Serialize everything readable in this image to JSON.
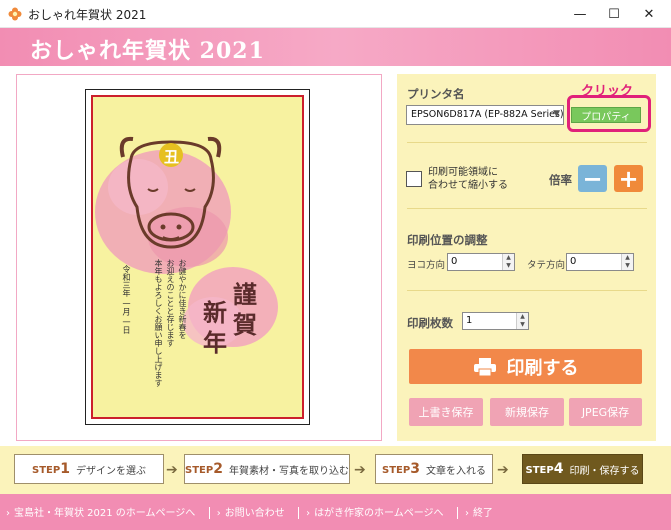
{
  "window": {
    "title": "おしゃれ年賀状 2021",
    "minimize": "—",
    "maximize": "☐",
    "close": "✕"
  },
  "header": {
    "logo": "おしゃれ年賀状 2021"
  },
  "preview": {
    "stamp_text": "丑",
    "greeting_big": [
      "謹",
      "賀",
      "新",
      "年"
    ],
    "body_lines": [
      "お健やかに佳き新春を",
      "お迎えのことと存じます",
      "本年もよろしくお願い申し上げます"
    ],
    "date": "令和三年 一月 一日"
  },
  "settings": {
    "printer_label": "プリンタ名",
    "printer_value": "EPSON6D817A (EP-882A Series)",
    "properties_button": "プロパティ",
    "annotation": "クリック",
    "fit_checkbox_line1": "印刷可能領域に",
    "fit_checkbox_line2": "合わせて縮小する",
    "scale_label": "倍率",
    "minus": "−",
    "plus": "+",
    "position_label": "印刷位置の調整",
    "h_label": "ヨコ方向",
    "h_value": "0",
    "v_label": "タテ方向",
    "v_value": "0",
    "copies_label": "印刷枚数",
    "copies_value": "1",
    "print_button": "印刷する",
    "overwrite_button": "上書き保存",
    "new_save_button": "新規保存",
    "jpeg_button": "JPEG保存"
  },
  "steps": [
    {
      "step": "STEP",
      "num": "1",
      "label": "デザインを選ぶ"
    },
    {
      "step": "STEP",
      "num": "2",
      "label": "年賀素材・写真を取り込む"
    },
    {
      "step": "STEP",
      "num": "3",
      "label": "文章を入れる"
    },
    {
      "step": "STEP",
      "num": "4",
      "label": "印刷・保存する"
    }
  ],
  "footer": {
    "link1": "宝島社・年賀状 2021 のホームページへ",
    "link2": "お問い合わせ",
    "link3": "はがき作家のホームページへ",
    "link4": "終了"
  },
  "colors": {
    "brand_pink": "#f28db3",
    "panel_yellow": "#fbf3bb",
    "print_orange": "#f2884a",
    "save_pink": "#f0a3b4",
    "property_green": "#79c85c",
    "highlight_magenta": "#e0217a"
  }
}
